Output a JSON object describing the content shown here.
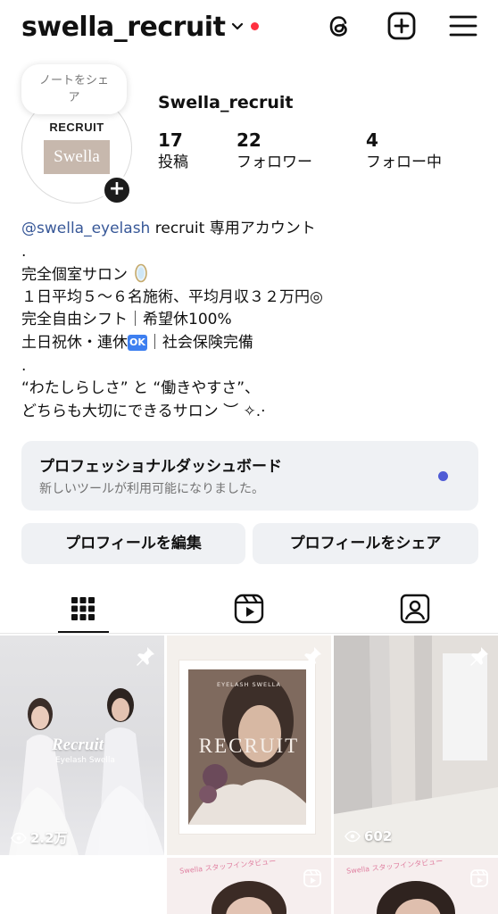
{
  "header": {
    "username": "swella_recruit",
    "icons": [
      "chevron-down-icon",
      "threads-icon",
      "create-icon",
      "menu-icon"
    ],
    "notification_color": "#ff3040"
  },
  "note": {
    "text": "ノートをシェア"
  },
  "avatar": {
    "logo_top": "RECRUIT",
    "logo_name": "Swella",
    "logo_bg": "#c7b8ad"
  },
  "profile": {
    "display_name": "Swella_recruit",
    "stats": [
      {
        "value": "17",
        "label": "投稿"
      },
      {
        "value": "22",
        "label": "フォロワー"
      },
      {
        "value": "4",
        "label": "フォロー中"
      }
    ]
  },
  "bio": {
    "mention": "@swella_eyelash",
    "line1_rest": " recruit 専用アカウント",
    "dot1": ".",
    "line2": "完全個室サロン",
    "line3": "１日平均５～６名施術、平均月収３２万円◎",
    "line4": "完全自由シフト｜希望休100%",
    "line5_a": "土日祝休・連休",
    "ok_badge": "OK",
    "line5_b": "｜社会保険完備",
    "dot2": ".",
    "line6": "“わたしらしさ” と “働きやすさ”、",
    "line7": "どちらも大切にできるサロン ︶ ✧.·"
  },
  "dashboard": {
    "title": "プロフェッショナルダッシュボード",
    "subtitle": "新しいツールが利用可能になりました。",
    "dot_color": "#4f5bd5"
  },
  "buttons": {
    "edit": "プロフィールを編集",
    "share": "プロフィールをシェア"
  },
  "tabs": [
    "grid-icon",
    "reels-icon",
    "tagged-icon"
  ],
  "posts": [
    {
      "title": "Recruit",
      "subtitle": "Eyelash Swella",
      "views": "2.2万",
      "pinned": true
    },
    {
      "brand": "EYELASH SWELLA",
      "title": "RECRUIT",
      "pinned": true
    },
    {
      "views": "602",
      "pinned": true
    },
    {
      "caption": "Swella スタッフインタビュー",
      "type": "reel"
    },
    {
      "caption": "Swella スタッフインタビュー",
      "type": "reel"
    }
  ]
}
